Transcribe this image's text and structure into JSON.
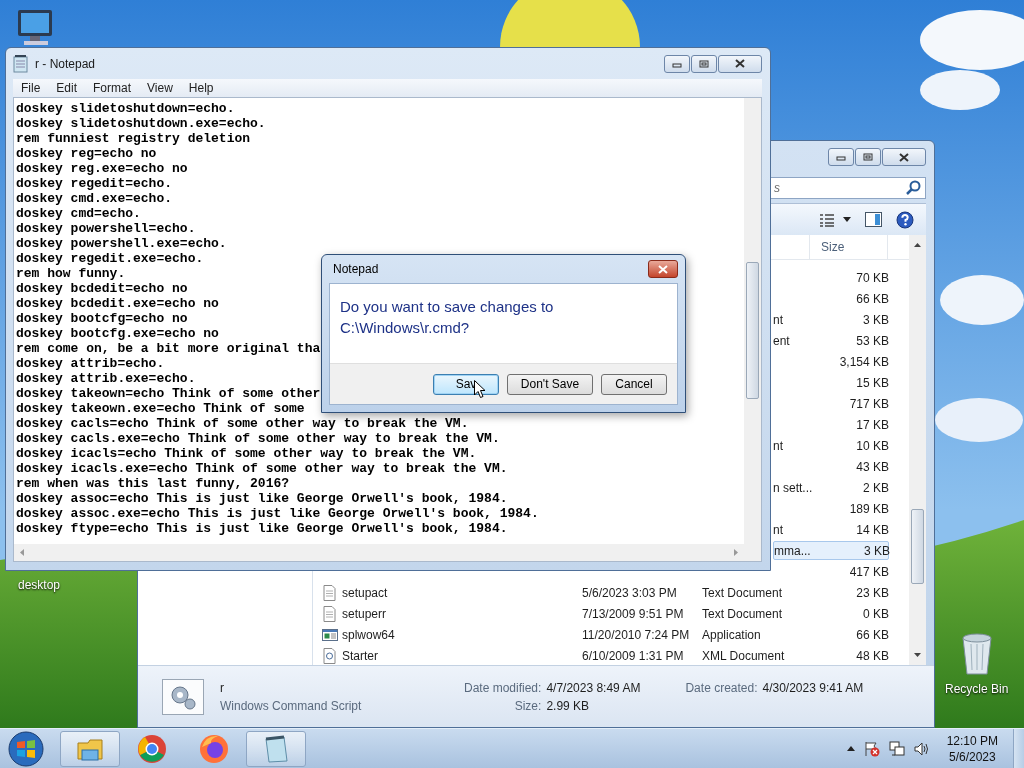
{
  "desktop": {
    "icons": [
      {
        "kind": "computer"
      },
      {
        "kind": "shortcut",
        "label": "desktop"
      },
      {
        "kind": "recycle-bin",
        "label": "Recycle Bin"
      }
    ]
  },
  "notepad": {
    "title": "r - Notepad",
    "menu": [
      "File",
      "Edit",
      "Format",
      "View",
      "Help"
    ],
    "lines": [
      "doskey slidetoshutdown=echo.",
      "doskey slidetoshutdown.exe=echo.",
      "rem funniest registry deletion",
      "doskey reg=echo no",
      "doskey reg.exe=echo no",
      "doskey regedit=echo.",
      "doskey cmd.exe=echo.",
      "doskey cmd=echo.",
      "doskey powershell=echo.",
      "doskey powershell.exe=echo.",
      "doskey regedit.exe=echo.",
      "rem how funny.",
      "doskey bcdedit=echo no",
      "doskey bcdedit.exe=echo no",
      "doskey bootcfg=echo no",
      "doskey bootcfg.exe=echo no",
      "rem come on, be a bit more original tha",
      "doskey attrib=echo.",
      "doskey attrib.exe=echo.",
      "doskey takeown=echo Think of some other",
      "doskey takeown.exe=echo Think of some",
      "doskey cacls=echo Think of some other way to break the VM.",
      "doskey cacls.exe=echo Think of some other way to break the VM.",
      "doskey icacls=echo Think of some other way to break the VM.",
      "doskey icacls.exe=echo Think of some other way to break the VM.",
      "rem when was this last funny, 2016?",
      "doskey assoc=echo This is just like George Orwell's book, 1984.",
      "doskey assoc.exe=echo This is just like George Orwell's book, 1984.",
      "doskey ftype=echo This is just like George Orwell's book, 1984."
    ]
  },
  "dialog": {
    "title": "Notepad",
    "message": "Do you want to save changes to C:\\Windows\\r.cmd?",
    "buttons": [
      {
        "label": "Sav",
        "default": true
      },
      {
        "label": "Don't Save",
        "default": false
      },
      {
        "label": "Cancel",
        "default": false
      }
    ]
  },
  "explorer": {
    "search": {
      "placeholder": "s"
    },
    "columns": [
      {
        "label": "Size"
      }
    ],
    "rows": [
      {
        "size": "70 KB",
        "selected": false
      },
      {
        "size": "66 KB",
        "selected": false
      },
      {
        "type": "nt",
        "size": "3 KB",
        "selected": false
      },
      {
        "type": "ent",
        "size": "53 KB",
        "selected": false
      },
      {
        "size": "3,154 KB",
        "selected": false
      },
      {
        "size": "15 KB",
        "selected": false
      },
      {
        "size": "717 KB",
        "selected": false
      },
      {
        "size": "17 KB",
        "selected": false
      },
      {
        "type": "nt",
        "size": "10 KB",
        "selected": false
      },
      {
        "size": "43 KB",
        "selected": false
      },
      {
        "type": "n sett...",
        "size": "2 KB",
        "selected": false
      },
      {
        "size": "189 KB",
        "selected": false
      },
      {
        "type": "nt",
        "size": "14 KB",
        "selected": false
      },
      {
        "type": "mma...",
        "size": "3 KB",
        "selected": true
      },
      {
        "size": "417 KB",
        "selected": false
      },
      {
        "kind": "text",
        "name": "setupact",
        "date": "5/6/2023 3:03 PM",
        "type": "Text Document",
        "size": "23 KB",
        "selected": false
      },
      {
        "kind": "text",
        "name": "setuperr",
        "date": "7/13/2009 9:51 PM",
        "type": "Text Document",
        "size": "0 KB",
        "selected": false
      },
      {
        "kind": "app",
        "name": "splwow64",
        "date": "11/20/2010 7:24 PM",
        "type": "Application",
        "size": "66 KB",
        "selected": false
      },
      {
        "kind": "xml",
        "name": "Starter",
        "date": "6/10/2009 1:31 PM",
        "type": "XML Document",
        "size": "48 KB",
        "selected": false
      }
    ],
    "details": {
      "name": "r",
      "type": "Windows Command Script",
      "fields": [
        {
          "label": "Date modified:",
          "value": "4/7/2023 8:49 AM"
        },
        {
          "label": "Size:",
          "value": "2.99 KB"
        },
        {
          "label": "Date created:",
          "value": "4/30/2023 9:41 AM"
        }
      ]
    }
  },
  "taskbar": {
    "apps": [
      {
        "kind": "explorer",
        "running": true
      },
      {
        "kind": "chrome",
        "running": false
      },
      {
        "kind": "firefox",
        "running": false
      },
      {
        "kind": "notepad",
        "running": true
      }
    ],
    "clock": {
      "time": "12:10 PM",
      "date": "5/6/2023"
    }
  }
}
